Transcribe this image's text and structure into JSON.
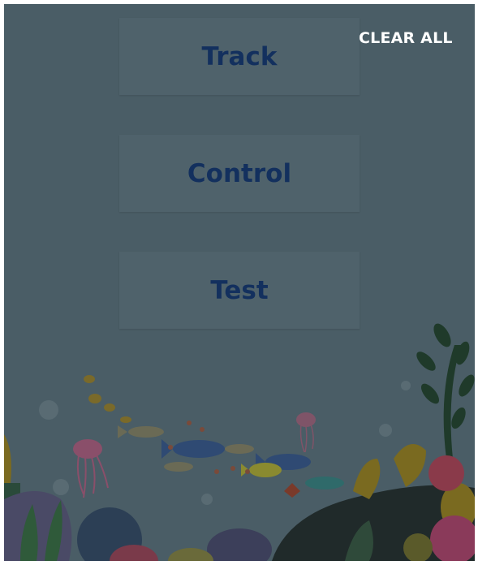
{
  "header": {
    "clear_all_label": "CLEAR ALL"
  },
  "menu": {
    "items": [
      {
        "label": "Track"
      },
      {
        "label": "Control"
      },
      {
        "label": "Test"
      }
    ]
  },
  "colors": {
    "overlay_background": "#4a5d66",
    "button_background": "#4f626b",
    "button_text": "#13305e",
    "clear_all_text": "#ffffff"
  },
  "background": {
    "illustration": "underwater-scene-with-fish-coral-jellyfish"
  }
}
